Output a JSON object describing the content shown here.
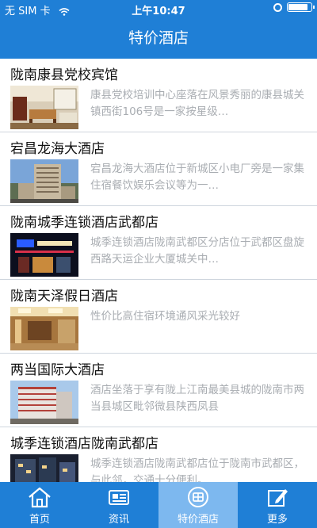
{
  "status": {
    "carrier": "无 SIM 卡",
    "time": "上午10:47"
  },
  "header": {
    "title": "特价酒店"
  },
  "hotels": [
    {
      "name": "陇南康县党校宾馆",
      "desc": "康县党校培训中心座落在风景秀丽的康县城关镇西街106号是一家按星级…"
    },
    {
      "name": "宕昌龙海大酒店",
      "desc": "宕昌龙海大酒店位于新城区小电厂旁是一家集住宿餐饮娱乐会议等为一…"
    },
    {
      "name": "陇南城季连锁酒店武都店",
      "desc": "城季连锁酒店陇南武都区分店位于武都区盘旋西路天运企业大厦城关中…"
    },
    {
      "name": "陇南天泽假日酒店",
      "desc": "性价比高住宿环境通风采光较好"
    },
    {
      "name": "两当国际大酒店",
      "desc": "酒店坐落于享有陇上江南最美县城的陇南市两当县城区毗邻微县陕西凤县"
    },
    {
      "name": "城季连锁酒店陇南武都店",
      "desc": "城季连锁酒店陇南武都店位于陇南市武都区，与此邻，交通十分便利。"
    }
  ],
  "tabs": [
    {
      "label": "首页",
      "icon": "home-icon"
    },
    {
      "label": "资讯",
      "icon": "news-icon"
    },
    {
      "label": "特价酒店",
      "icon": "hotel-icon",
      "active": true
    },
    {
      "label": "更多",
      "icon": "edit-icon"
    }
  ],
  "colors": {
    "brand": "#1f7fd6",
    "active_tab": "#7db8ef",
    "desc_text": "#a9adb2"
  }
}
